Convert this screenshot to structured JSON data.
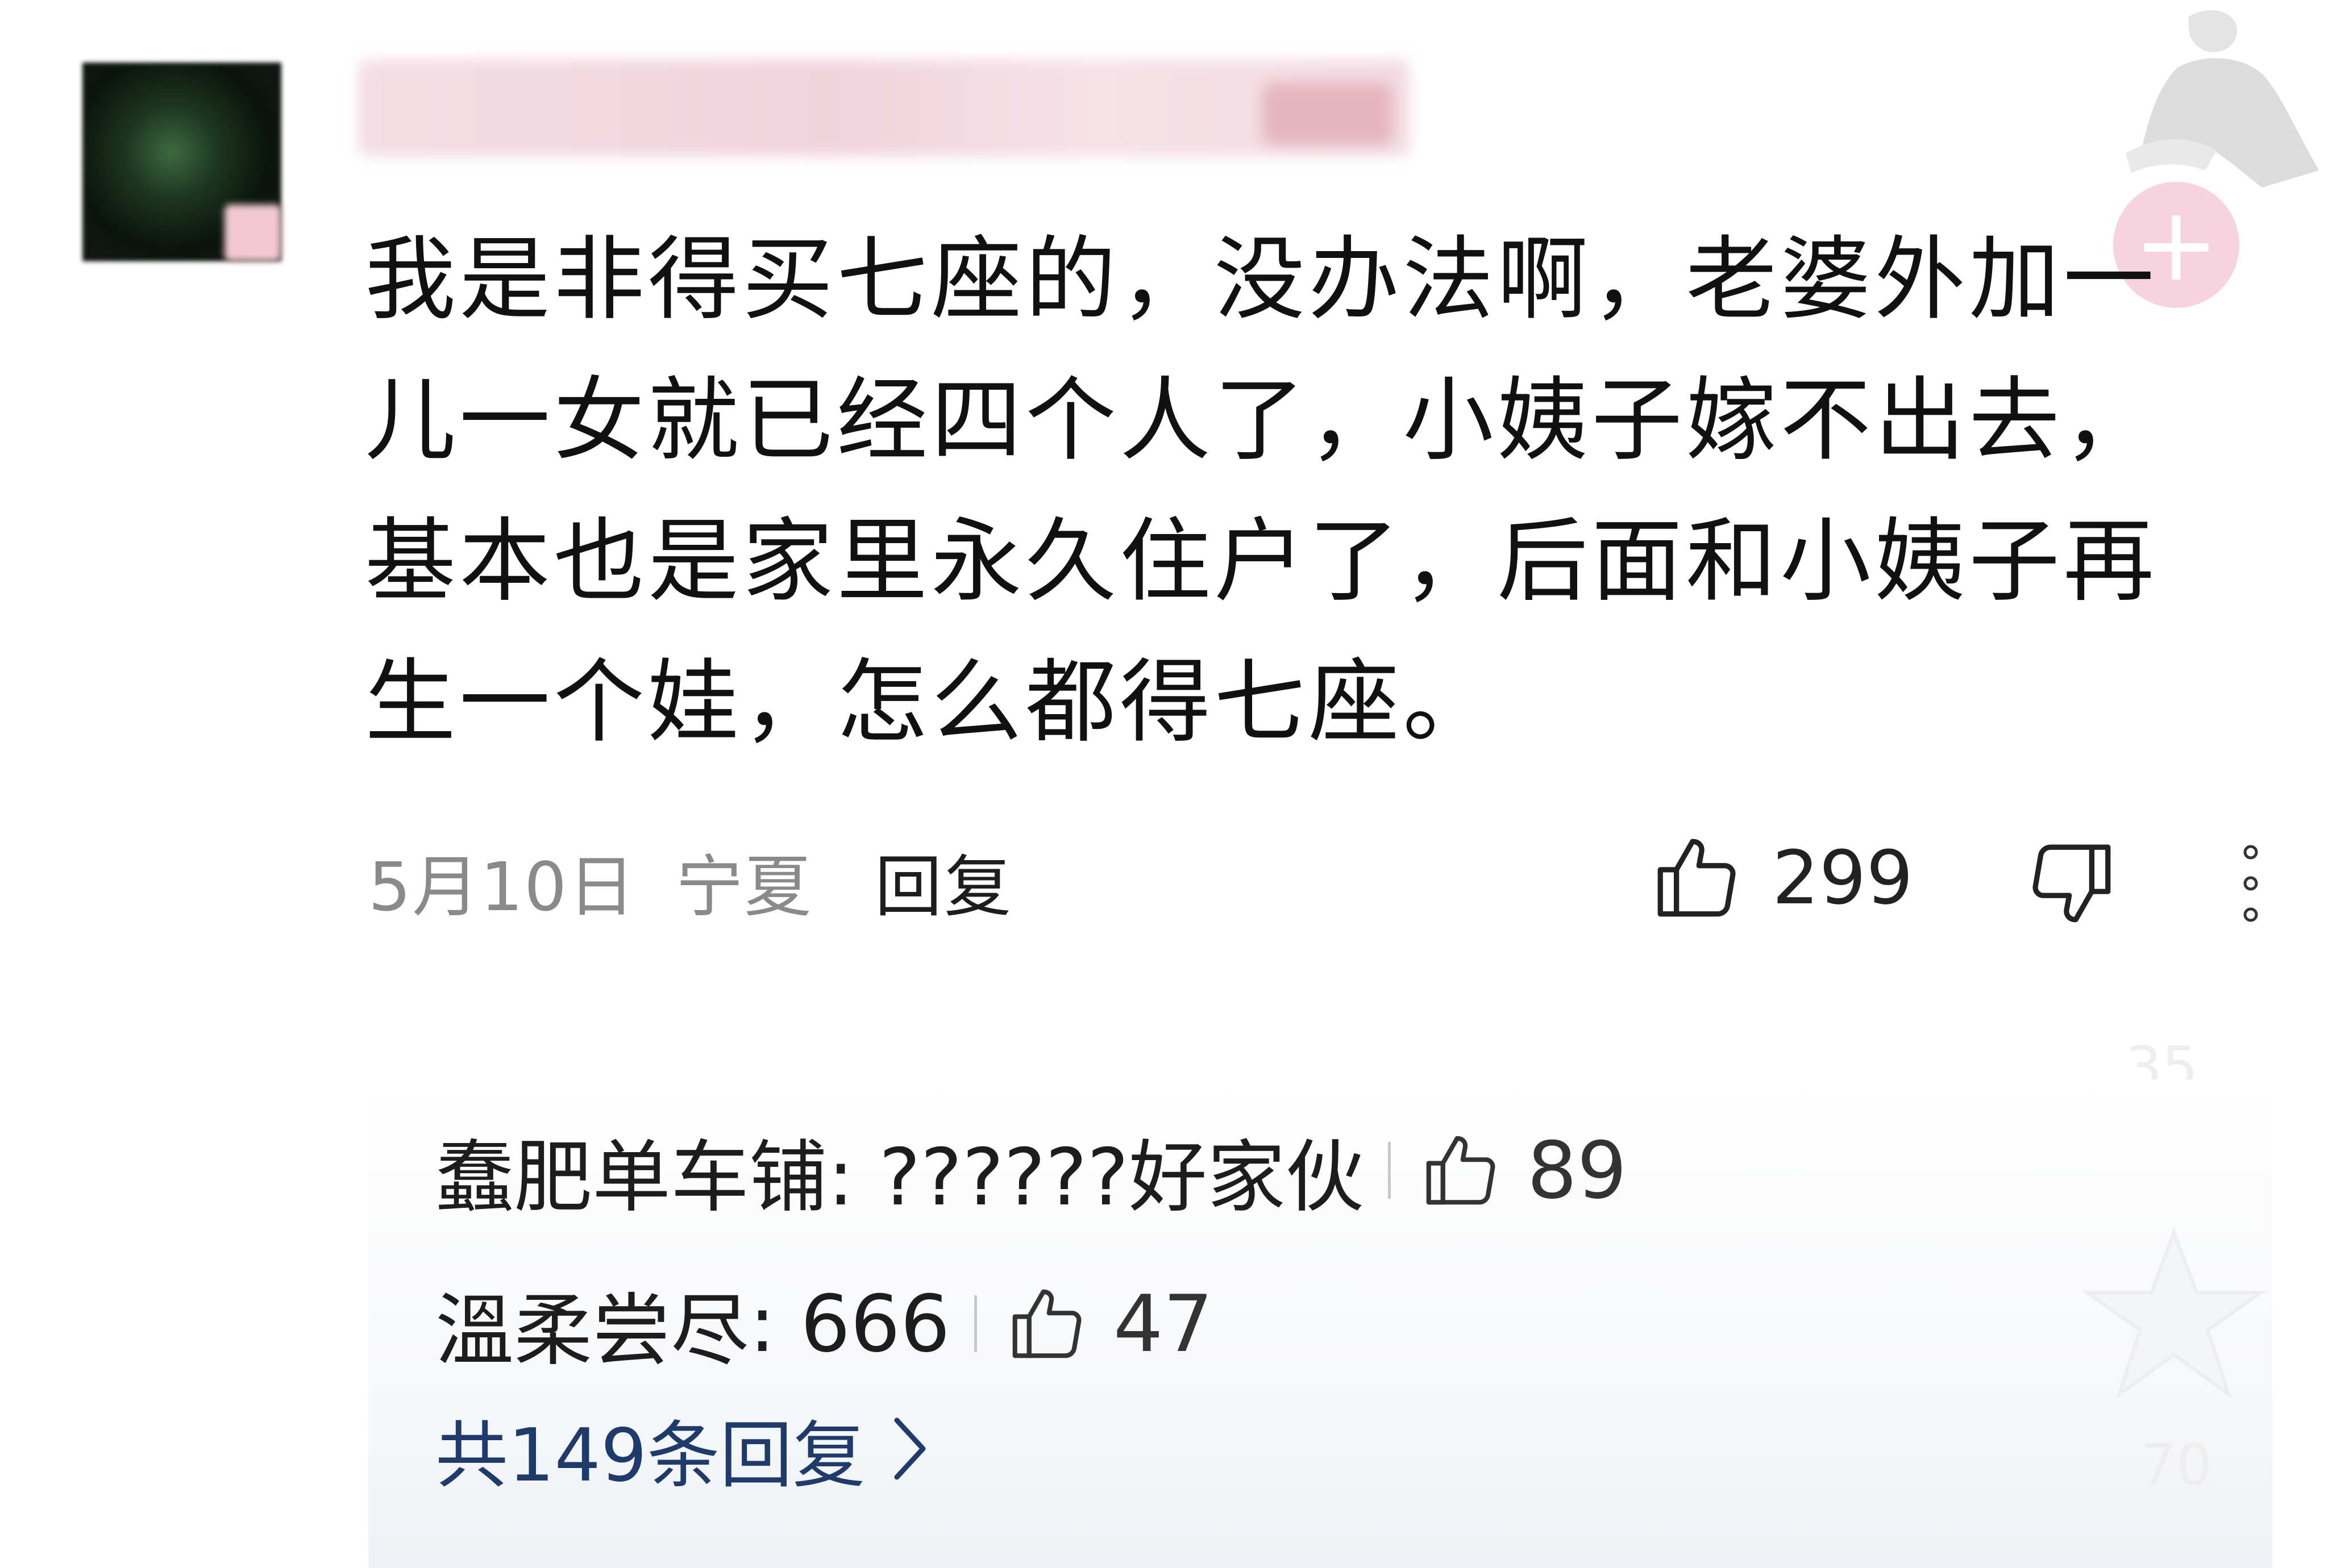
{
  "comment": {
    "text": "我是非得买七座的，没办法啊，老婆外加一儿一女就已经四个人了，小姨子嫁不出去，基本也是家里永久住户了，后面和小姨子再生一个娃，怎么都得七座。",
    "date": "5月10日",
    "location": "宁夏",
    "reply_label": "回复",
    "like_count": "299"
  },
  "top_right": {
    "plus_label": "+"
  },
  "replies": {
    "items": [
      {
        "author": "蠢肥单车铺",
        "text": ": ??????好家伙",
        "likes": "89"
      },
      {
        "author": "溫柔尝尽",
        "text": ": 666",
        "likes": "47"
      }
    ],
    "total_label": "共149条回复"
  },
  "ghost_numbers": {
    "top": "35",
    "bottom": "70"
  },
  "icons": {
    "like": "thumbs-up-icon",
    "dislike": "thumbs-down-icon",
    "more": "more-vertical-icon",
    "chevron": "chevron-right-icon",
    "plus": "plus-circle-icon"
  },
  "colors": {
    "text": "#111111",
    "meta": "#8a8a8a",
    "link": "#1f3b6b",
    "plus_bg": "#f7d3df"
  }
}
